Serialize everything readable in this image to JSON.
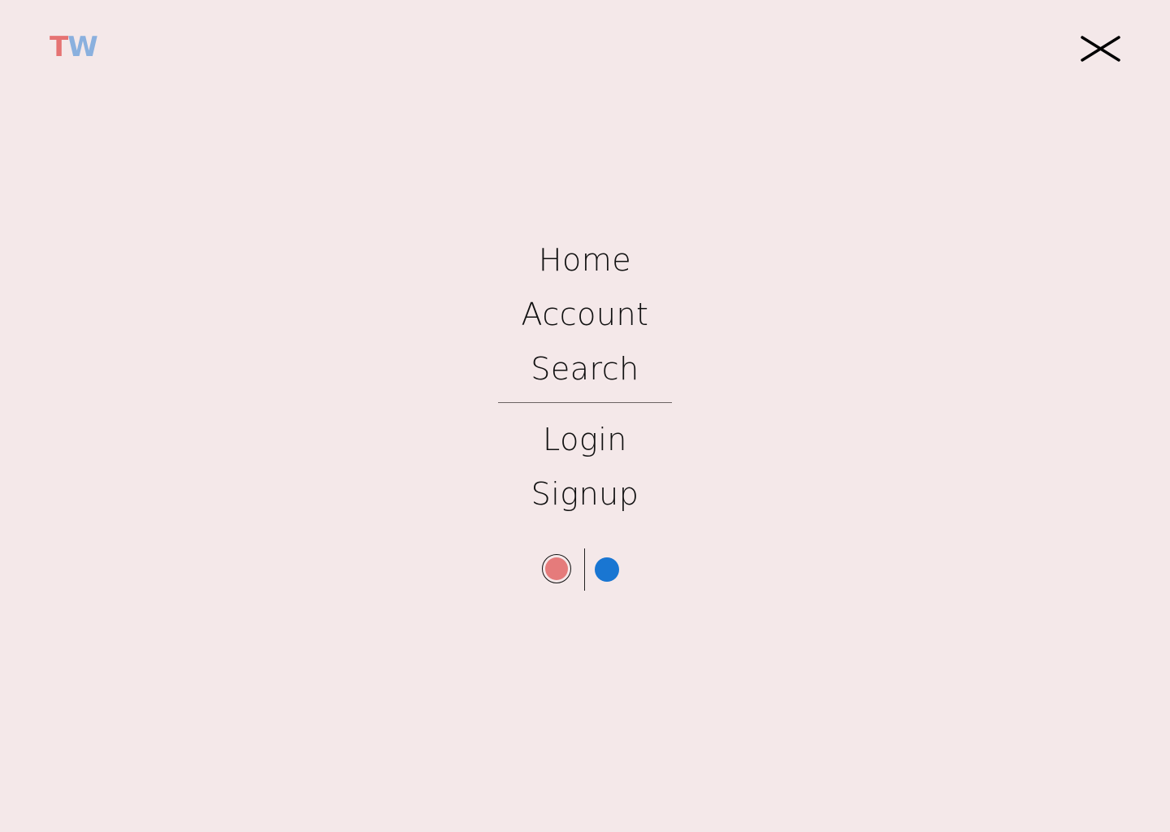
{
  "logo": {
    "letter_t": "T",
    "letter_w": "W"
  },
  "header": {
    "close_icon": "close-icon"
  },
  "menu": {
    "items": [
      {
        "label": "Home"
      },
      {
        "label": "Account"
      },
      {
        "label": "Search"
      }
    ],
    "auth_items": [
      {
        "label": "Login"
      },
      {
        "label": "Signup"
      }
    ]
  },
  "theme_switch": {
    "options": [
      {
        "name": "red",
        "color": "#e57b7b",
        "selected": true
      },
      {
        "name": "blue",
        "color": "#1976d2",
        "selected": false
      }
    ]
  },
  "colors": {
    "background": "#f4e8e9",
    "logo_t": "#e57373",
    "logo_w": "#8ab0de",
    "text": "#111111"
  }
}
